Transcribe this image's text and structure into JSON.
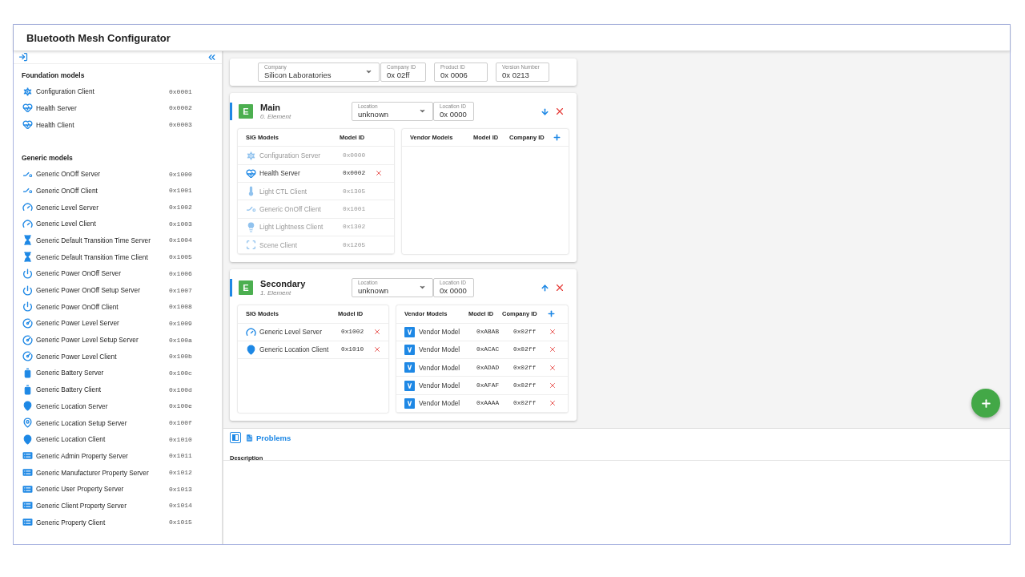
{
  "window": {
    "title": "Bluetooth Mesh Configurator"
  },
  "sidebar": {
    "groups": [
      {
        "title": "Foundation models",
        "models": [
          {
            "name": "Configuration Client",
            "id": "0x0001",
            "kind": "configuration"
          },
          {
            "name": "Health Server",
            "id": "0x0002",
            "kind": "health"
          },
          {
            "name": "Health Client",
            "id": "0x0003",
            "kind": "health"
          }
        ]
      },
      {
        "title": "Generic models",
        "models": [
          {
            "name": "Generic OnOff Server",
            "id": "0x1000",
            "kind": "onoff"
          },
          {
            "name": "Generic OnOff Client",
            "id": "0x1001",
            "kind": "onoff"
          },
          {
            "name": "Generic Level Server",
            "id": "0x1002",
            "kind": "level"
          },
          {
            "name": "Generic Level Client",
            "id": "0x1003",
            "kind": "level"
          },
          {
            "name": "Generic Default Transition Time Server",
            "id": "0x1004",
            "kind": "transition"
          },
          {
            "name": "Generic Default Transition Time Client",
            "id": "0x1005",
            "kind": "transition"
          },
          {
            "name": "Generic Power OnOff Server",
            "id": "0x1006",
            "kind": "power"
          },
          {
            "name": "Generic Power OnOff Setup Server",
            "id": "0x1007",
            "kind": "power-setup"
          },
          {
            "name": "Generic Power OnOff Client",
            "id": "0x1008",
            "kind": "power"
          },
          {
            "name": "Generic Power Level Server",
            "id": "0x1009",
            "kind": "power-level"
          },
          {
            "name": "Generic Power Level Setup Server",
            "id": "0x100a",
            "kind": "power-level"
          },
          {
            "name": "Generic Power Level Client",
            "id": "0x100b",
            "kind": "power-level"
          },
          {
            "name": "Generic Battery Server",
            "id": "0x100c",
            "kind": "battery"
          },
          {
            "name": "Generic Battery Client",
            "id": "0x100d",
            "kind": "battery"
          },
          {
            "name": "Generic Location Server",
            "id": "0x100e",
            "kind": "location"
          },
          {
            "name": "Generic Location Setup Server",
            "id": "0x100f",
            "kind": "location-setup"
          },
          {
            "name": "Generic Location Client",
            "id": "0x1010",
            "kind": "location"
          },
          {
            "name": "Generic Admin Property Server",
            "id": "0x1011",
            "kind": "property"
          },
          {
            "name": "Generic Manufacturer Property Server",
            "id": "0x1012",
            "kind": "property"
          },
          {
            "name": "Generic User Property Server",
            "id": "0x1013",
            "kind": "property"
          },
          {
            "name": "Generic Client Property Server",
            "id": "0x1014",
            "kind": "property"
          },
          {
            "name": "Generic Property Client",
            "id": "0x1015",
            "kind": "property"
          }
        ]
      }
    ]
  },
  "device": {
    "company": {
      "label": "Company",
      "value": "Silicon Laboratories"
    },
    "fields": [
      {
        "label": "Company ID",
        "value": "0x 02ff"
      },
      {
        "label": "Product ID",
        "value": "0x 0006"
      },
      {
        "label": "Version Number",
        "value": "0x 0213"
      }
    ]
  },
  "elements": [
    {
      "badge": "E",
      "name": "Main",
      "subtitle": "0. Element",
      "location": {
        "label": "Location",
        "value": "unknown"
      },
      "location_id": {
        "label": "Location ID",
        "value": "0x 0000"
      },
      "move_down": true,
      "sig_columns": [
        "SIG Models",
        "Model ID"
      ],
      "sig_models": [
        {
          "name": "Configuration Server",
          "id": "0x0000",
          "kind": "configuration",
          "disabled": true
        },
        {
          "name": "Health Server",
          "id": "0x0002",
          "kind": "health",
          "disabled": false
        },
        {
          "name": "Light CTL Client",
          "id": "0x1305",
          "kind": "ctl",
          "disabled": true
        },
        {
          "name": "Generic OnOff Client",
          "id": "0x1001",
          "kind": "onoff",
          "disabled": true
        },
        {
          "name": "Light Lightness Client",
          "id": "0x1302",
          "kind": "lightness",
          "disabled": true
        },
        {
          "name": "Scene Client",
          "id": "0x1205",
          "kind": "scene",
          "disabled": true
        }
      ],
      "vendor_columns": [
        "Vendor Models",
        "Model ID",
        "Company ID"
      ]
    },
    {
      "badge": "E",
      "name": "Secondary",
      "subtitle": "1. Element",
      "location": {
        "label": "Location",
        "value": "unknown"
      },
      "location_id": {
        "label": "Location ID",
        "value": "0x 0000"
      },
      "move_down": false,
      "sig_columns": [
        "SIG Models",
        "Model ID"
      ],
      "sig_models": [
        {
          "name": "Generic Level Server",
          "id": "0x1002",
          "kind": "level",
          "disabled": false
        },
        {
          "name": "Generic Location Client",
          "id": "0x1010",
          "kind": "location",
          "disabled": false
        }
      ],
      "vendor_columns": [
        "Vendor Models",
        "Model ID",
        "Company ID"
      ],
      "vendor_models": [
        {
          "name": "Vendor Model",
          "id": "0xABAB",
          "company_id": "0x02ff"
        },
        {
          "name": "Vendor Model",
          "id": "0xACAC",
          "company_id": "0x02ff"
        },
        {
          "name": "Vendor Model",
          "id": "0xADAD",
          "company_id": "0x02ff"
        },
        {
          "name": "Vendor Model",
          "id": "0xAFAF",
          "company_id": "0x02ff"
        },
        {
          "name": "Vendor Model",
          "id": "0xAAAA",
          "company_id": "0x02ff"
        }
      ]
    }
  ],
  "problems": {
    "tab": "Problems",
    "columns": [
      "Description"
    ]
  }
}
